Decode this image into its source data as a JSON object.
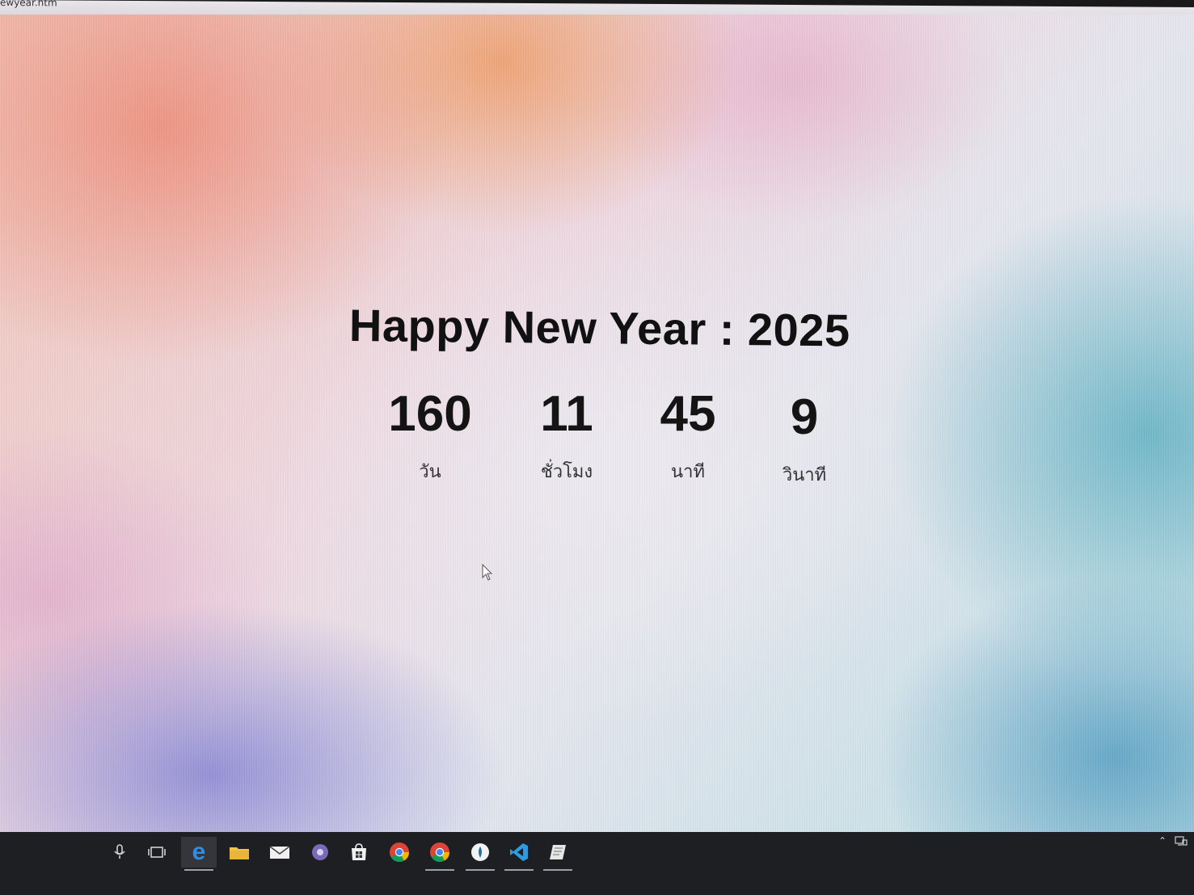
{
  "browser": {
    "url_fragment": "ewyear.htm"
  },
  "page": {
    "title": "Happy New Year : 2025",
    "countdown": [
      {
        "value": "160",
        "label": "วัน"
      },
      {
        "value": "11",
        "label": "ชั่วโมง"
      },
      {
        "value": "45",
        "label": "นาที"
      },
      {
        "value": "9",
        "label": "วินาที"
      }
    ]
  },
  "taskbar": {
    "items": [
      {
        "icon": "microphone-icon"
      },
      {
        "icon": "task-view-icon"
      },
      {
        "icon": "edge-browser-icon",
        "active": true
      },
      {
        "icon": "file-explorer-icon"
      },
      {
        "icon": "mail-icon"
      },
      {
        "icon": "media-player-icon"
      },
      {
        "icon": "microsoft-store-icon"
      },
      {
        "icon": "chrome-icon"
      },
      {
        "icon": "chrome-icon",
        "running": true
      },
      {
        "icon": "app-drop-icon",
        "running": true
      },
      {
        "icon": "vscode-icon",
        "running": true
      },
      {
        "icon": "notes-app-icon",
        "running": true
      }
    ],
    "tray": {
      "icons": [
        "chevron-up-icon",
        "network-icon"
      ]
    }
  },
  "colors": {
    "text_dark": "#111111",
    "taskbar_bg": "#1e1f22"
  }
}
